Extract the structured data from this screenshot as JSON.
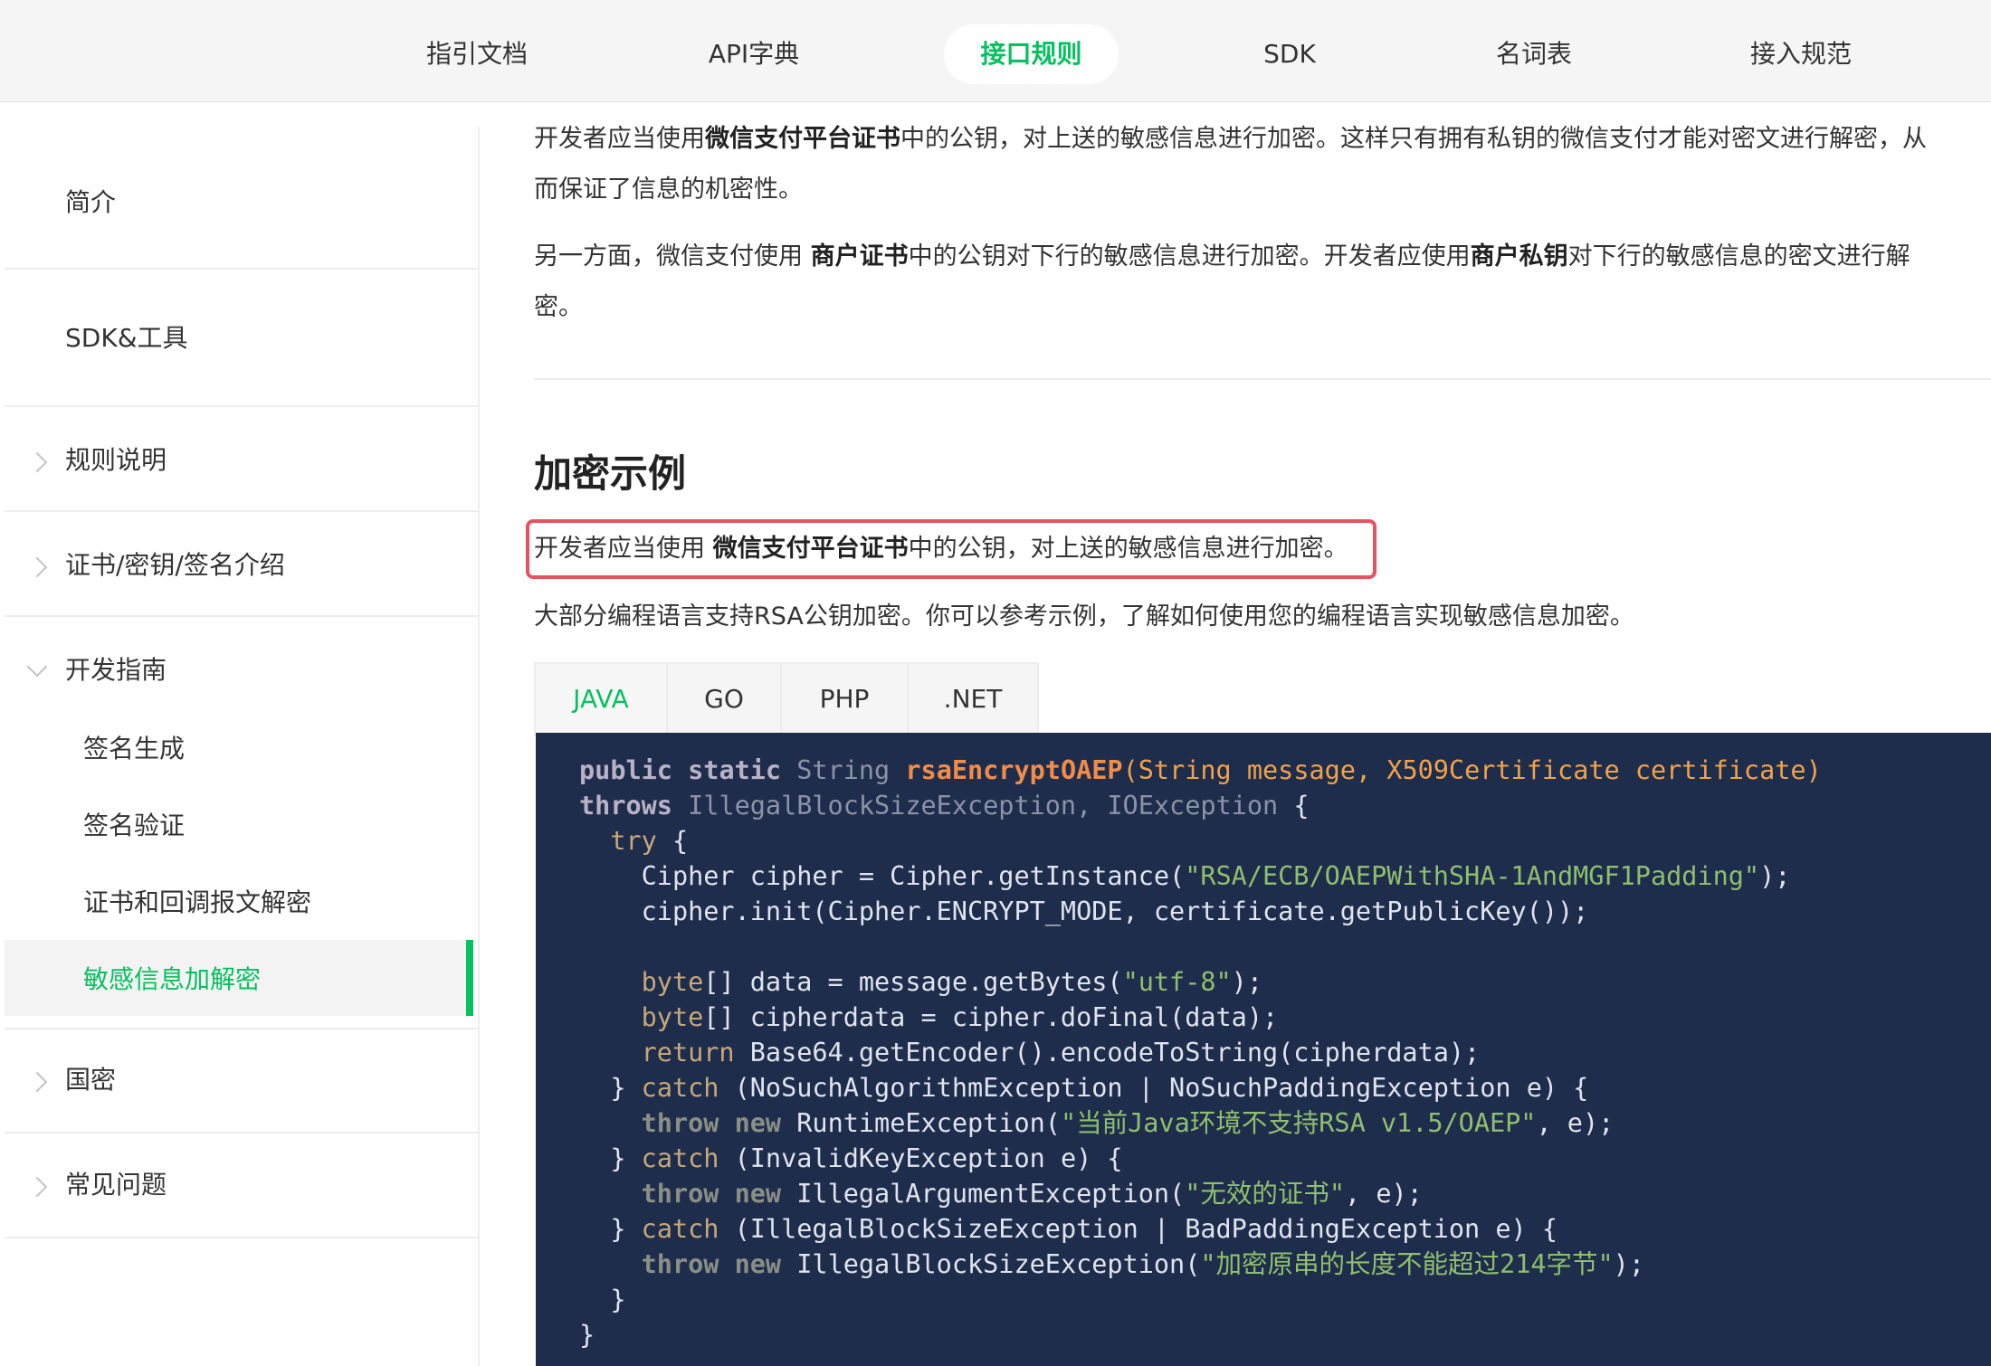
{
  "topnav": {
    "tabs": [
      {
        "label": "指引文档",
        "active": false
      },
      {
        "label": "API字典",
        "active": false
      },
      {
        "label": "接口规则",
        "active": true
      },
      {
        "label": "SDK",
        "active": false
      },
      {
        "label": "名词表",
        "active": false
      },
      {
        "label": "接入规范",
        "active": false
      }
    ],
    "accent_color": "#07c160"
  },
  "sidebar": {
    "items": [
      {
        "label": "简介",
        "icon": null
      },
      {
        "label": "SDK&工具",
        "icon": null
      },
      {
        "label": "规则说明",
        "icon": "chevron-right-icon"
      },
      {
        "label": "证书/密钥/签名介绍",
        "icon": "chevron-right-icon"
      },
      {
        "label": "开发指南",
        "icon": "chevron-down-icon",
        "expanded": true
      },
      {
        "label": "国密",
        "icon": "chevron-right-icon"
      },
      {
        "label": "常见问题",
        "icon": "chevron-right-icon"
      }
    ],
    "subitems": [
      {
        "label": "签名生成",
        "active": false
      },
      {
        "label": "签名验证",
        "active": false
      },
      {
        "label": "证书和回调报文解密",
        "active": false
      },
      {
        "label": "敏感信息加解密",
        "active": true
      }
    ]
  },
  "main": {
    "intro1": {
      "line1_a": "开发者应当使用",
      "line1_b": "微信支付平台证书",
      "line1_c": "中的公钥，对上送的敏感信息进行加密。这样只有拥有私钥的微信支付才能对密文进行解密，从",
      "line2": "而保证了信息的机密性。"
    },
    "intro2": {
      "line1_a": "另一方面，微信支付使用 ",
      "line1_b": "商户证书",
      "line1_c": "中的公钥对下行的敏感信息进行加密。开发者应使用",
      "line1_d": "商户私钥",
      "line1_e": "对下行的敏感信息的密文进行解",
      "line2": "密。"
    },
    "section_title": "加密示例",
    "highlight": {
      "a": "开发者应当使用 ",
      "b": "微信支付平台证书",
      "c": "中的公钥，对上送的敏感信息进行加密。"
    },
    "desc": "大部分编程语言支持RSA公钥加密。你可以参考示例，了解如何使用您的编程语言实现敏感信息加密。",
    "code_tabs": [
      {
        "label": "JAVA",
        "active": true
      },
      {
        "label": "GO",
        "active": false
      },
      {
        "label": "PHP",
        "active": false
      },
      {
        "label": ".NET",
        "active": false
      }
    ],
    "code": {
      "l1_kw1": "public",
      "l1_kw2": "static",
      "l1_type": "String",
      "l1_fn": "rsaEncryptOAEP",
      "l1_params": "(String message, X509Certificate certificate)",
      "l2_kw": "throws",
      "l2_ex": "IllegalBlockSizeException, IOException",
      "l2_tail": " {",
      "l3_kw": "try",
      "l3_tail": " {",
      "l4_a": "Cipher cipher = Cipher.getInstance(",
      "l4_str": "\"RSA/ECB/OAEPWithSHA-1AndMGF1Padding\"",
      "l4_b": ");",
      "l5": "cipher.init(Cipher.ENCRYPT_MODE, certificate.getPublicKey());",
      "l7_kw": "byte",
      "l7_a": "[] data = message.getBytes(",
      "l7_str": "\"utf-8\"",
      "l7_b": ");",
      "l8_kw": "byte",
      "l8_a": "[] cipherdata = cipher.doFinal(data);",
      "l9_kw": "return",
      "l9_a": " Base64.getEncoder().encodeToString(cipherdata);",
      "l10_a": "} ",
      "l10_kw": "catch",
      "l10_b": " (NoSuchAlgorithmException | NoSuchPaddingException e) {",
      "l11_kw1": "throw",
      "l11_kw2": "new",
      "l11_a": " RuntimeException(",
      "l11_str": "\"当前Java环境不支持RSA v1.5/OAEP\"",
      "l11_b": ", e);",
      "l12_a": "} ",
      "l12_kw": "catch",
      "l12_b": " (InvalidKeyException e) {",
      "l13_kw1": "throw",
      "l13_kw2": "new",
      "l13_a": " IllegalArgumentException(",
      "l13_str": "\"无效的证书\"",
      "l13_b": ", e);",
      "l14_a": "} ",
      "l14_kw": "catch",
      "l14_b": " (IllegalBlockSizeException | BadPaddingException e) {",
      "l15_kw1": "throw",
      "l15_kw2": "new",
      "l15_a": " IllegalBlockSizeException(",
      "l15_str": "\"加密原串的长度不能超过214字节\"",
      "l15_b": ");",
      "l16": "}",
      "l17": "}"
    }
  }
}
